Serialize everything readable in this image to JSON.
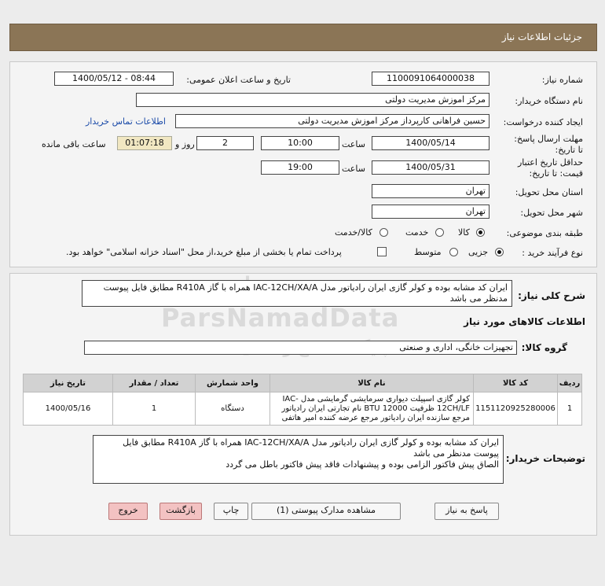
{
  "header": {
    "title": "جزئیات اطلاعات نیاز"
  },
  "form": {
    "need_number_label": "شماره نیاز:",
    "need_number": "1100091064000038",
    "announce_label": "تاریخ و ساعت اعلان عمومی:",
    "announce_value": "1400/05/12 - 08:44",
    "buyer_org_label": "نام دستگاه خریدار:",
    "buyer_org": "مرکز اموزش مدیریت دولتی",
    "creator_label": "ایجاد کننده درخواست:",
    "creator": "حسین  فراهانی کارپرداز مرکز اموزش مدیریت دولتی",
    "contact_link": "اطلاعات تماس خریدار",
    "deadline_label": "مهلت ارسال پاسخ: تا تاریخ:",
    "deadline_date": "1400/05/14",
    "time_label": "ساعت",
    "deadline_time": "10:00",
    "days_value": "2",
    "days_label": "روز و",
    "remaining_time": "01:07:18",
    "remaining_label": "ساعت باقی مانده",
    "validity_label": "حداقل تاریخ اعتبار قیمت: تا تاریخ:",
    "validity_date": "1400/05/31",
    "validity_time": "19:00",
    "province_label": "استان محل تحویل:",
    "province": "تهران",
    "city_label": "شهر محل تحویل:",
    "city": "تهران",
    "category_label": "طبقه بندی موضوعی:",
    "category_options": [
      "کالا",
      "خدمت",
      "کالا/خدمت"
    ],
    "process_label": "نوع فرآیند خرید :",
    "process_options": [
      "جزیی",
      "متوسط"
    ],
    "payment_note": "پرداخت تمام یا بخشی از مبلغ خرید،از محل \"اسناد خزانه اسلامی\" خواهد بود."
  },
  "need": {
    "summary_label": "شرح کلی نیاز:",
    "summary": "ایران کد مشابه بوده و کولر گازی ایران رادیاتور مدل IAC-12CH/XA/A همراه با گاز R410A مطابق فایل پیوست مدنظر می باشد",
    "items_heading": "اطلاعات کالاهای مورد نیاز",
    "group_label": "گروه کالا:",
    "group_value": "تجهیزات خانگی، اداری و صنعتی"
  },
  "table": {
    "headers": [
      "ردیف",
      "کد کالا",
      "نام کالا",
      "واحد شمارش",
      "تعداد / مقدار",
      "تاریخ نیاز"
    ],
    "rows": [
      {
        "row": "1",
        "code": "1151120925280006",
        "name": "کولر گازی اسپیلت دیواری سرمایشی گرمایشی مدل IAC-12CH/LF ظرفیت 12000 BTU نام تجارتی ایران رادیاتور مرجع سازنده ایران رادیاتور مرجع عرضه کننده امیر هاتفی",
        "unit": "دستگاه",
        "qty": "1",
        "date": "1400/05/16"
      }
    ]
  },
  "buyer_notes": {
    "label": "توضیحات خریدار:",
    "text": "ایران کد مشابه بوده و کولر گازی ایران رادیاتور مدل IAC-12CH/XA/A همراه با گاز R410A مطابق فایل پیوست مدنظر می باشد\nالصاق پیش فاکتور الزامی بوده و پیشنهادات فاقد پیش فاکتور باطل می گردد"
  },
  "buttons": {
    "reply": "پاسخ به نیاز",
    "attachments": "مشاهده مدارک پیوستی (1)",
    "print": "چاپ",
    "back": "بازگشت",
    "exit": "خروج"
  }
}
